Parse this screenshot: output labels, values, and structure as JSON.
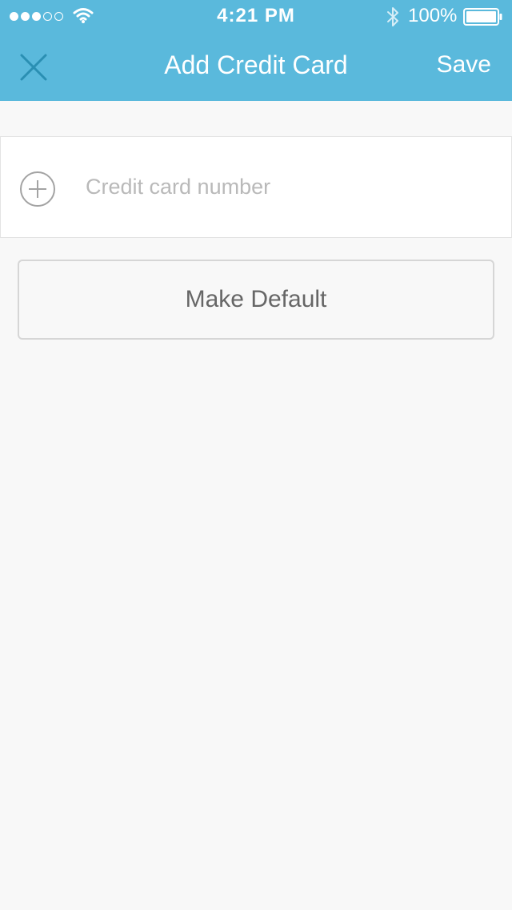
{
  "status_bar": {
    "time": "4:21 PM",
    "battery_percent": "100%",
    "signal_bars_filled": 3,
    "signal_bars_total": 5
  },
  "nav": {
    "title": "Add Credit Card",
    "save_label": "Save",
    "close_icon": "close-icon"
  },
  "form": {
    "card_number_placeholder": "Credit card number",
    "card_number_value": "",
    "add_icon": "plus-circle-icon"
  },
  "actions": {
    "make_default_label": "Make Default"
  },
  "colors": {
    "header_bg": "#5ab9dc",
    "close_icon": "#2a8fb3",
    "page_bg": "#f8f8f8"
  }
}
